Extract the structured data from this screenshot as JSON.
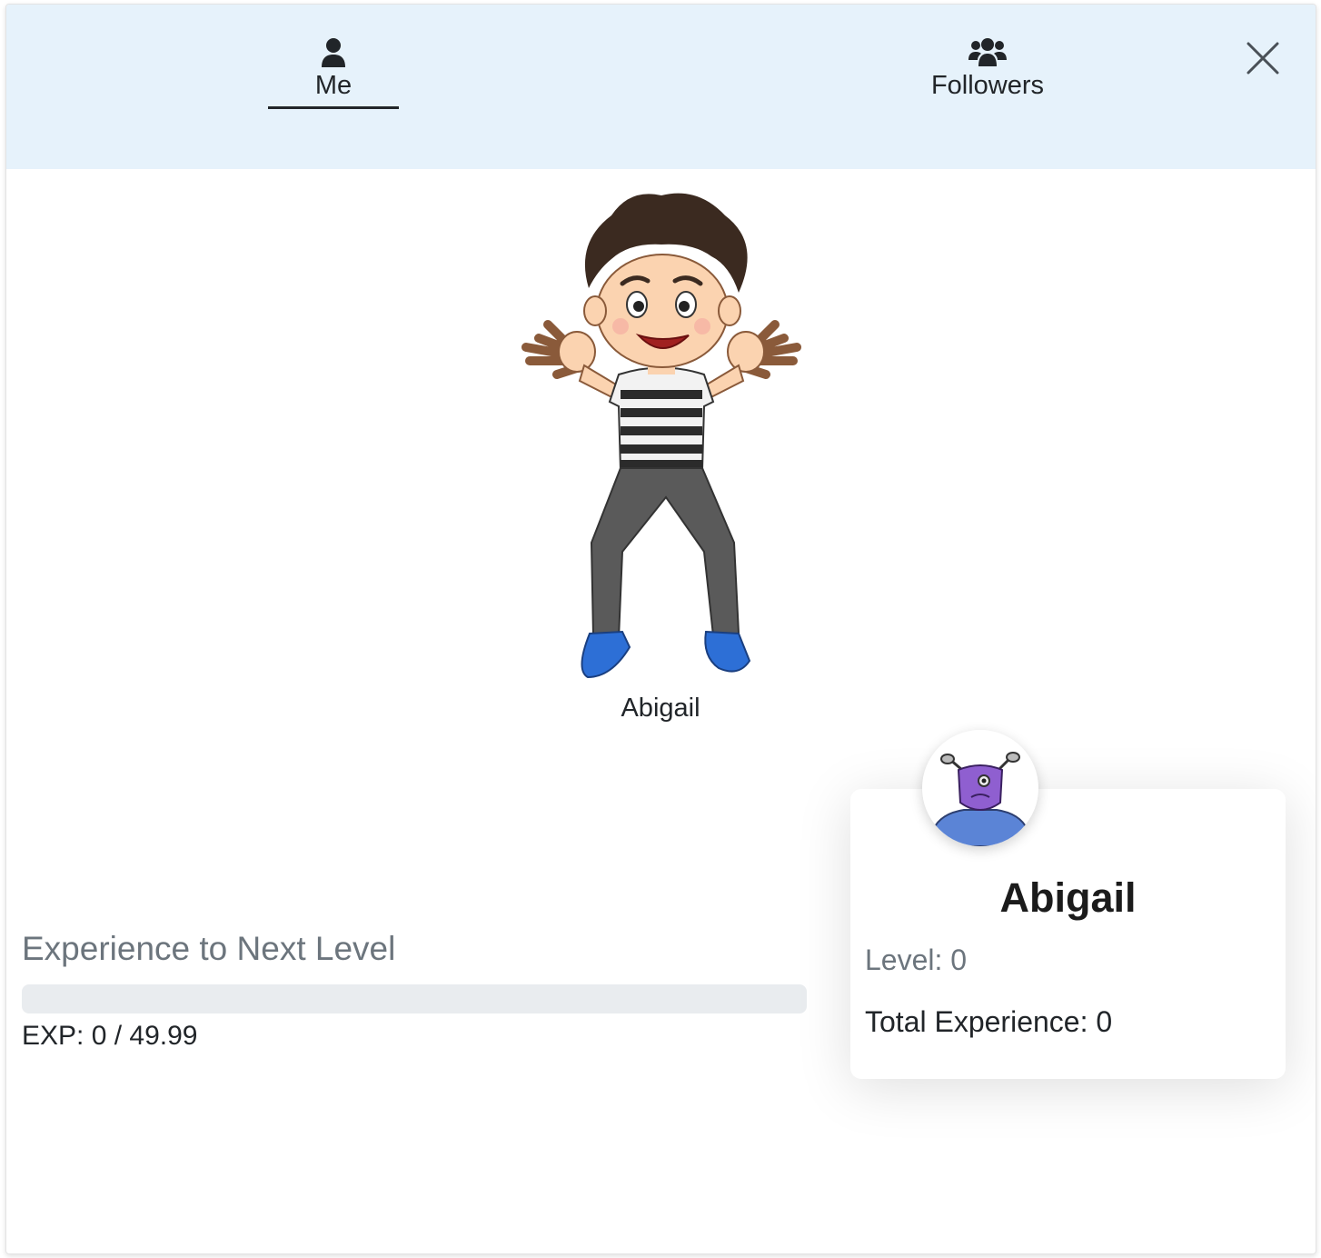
{
  "tabs": {
    "me": {
      "label": "Me",
      "icon": "user-icon",
      "active": true
    },
    "followers": {
      "label": "Followers",
      "icon": "users-icon",
      "active": false
    }
  },
  "close_icon": "close-icon",
  "character": {
    "name": "Abigail",
    "image": "cartoon-boy-striped-shirt"
  },
  "experience": {
    "title": "Experience to Next Level",
    "text": "EXP: 0 / 49.99",
    "progress_fraction": 0,
    "bar_color": "#e9ecef"
  },
  "profile_card": {
    "avatar": "purple-alien-avatar",
    "name": "Abigail",
    "level": "Level: 0",
    "total_experience": "Total Experience: 0"
  },
  "colors": {
    "header_bg": "#e6f2fb",
    "text": "#212529",
    "muted": "#6c757d"
  }
}
